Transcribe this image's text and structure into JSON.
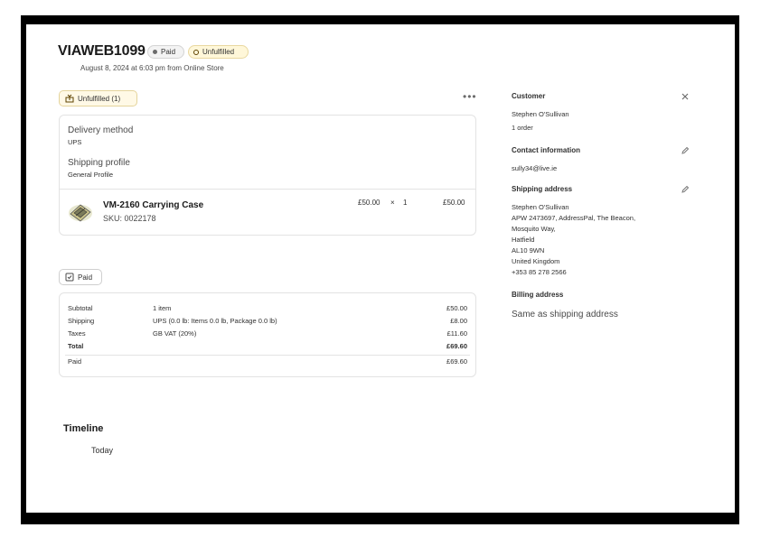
{
  "order": {
    "title": "VIAWEB1099",
    "badge_paid": "Paid",
    "badge_unfulfilled": "Unfulfilled",
    "subtitle": "August 8, 2024 at 6:03 pm from Online Store"
  },
  "fulfillment": {
    "status_label": "Unfulfilled (1)",
    "delivery_method_label": "Delivery method",
    "delivery_method_value": "UPS",
    "shipping_profile_label": "Shipping profile",
    "shipping_profile_value": "General Profile",
    "item": {
      "name": "VM-2160 Carrying Case",
      "sku": "SKU: 0022178",
      "price": "£50.00",
      "times": "×",
      "qty": "1",
      "total": "£50.00"
    }
  },
  "payment": {
    "status_label": "Paid",
    "rows": [
      {
        "label": "Subtotal",
        "detail": "1 item",
        "amount": "£50.00"
      },
      {
        "label": "Shipping",
        "detail": "UPS (0.0 lb: Items 0.0 lb, Package 0.0 lb)",
        "amount": "£8.00"
      },
      {
        "label": "Taxes",
        "detail": "GB VAT (20%)",
        "amount": "£11.60"
      },
      {
        "label": "Total",
        "detail": "",
        "amount": "£69.60"
      },
      {
        "label": "Paid",
        "detail": "",
        "amount": "£69.60"
      }
    ]
  },
  "timeline": {
    "heading": "Timeline",
    "today": "Today"
  },
  "customer": {
    "heading": "Customer",
    "name": "Stephen O'Sullivan",
    "orders": "1 order",
    "contact_heading": "Contact information",
    "email": "sully34@live.ie",
    "shipping_heading": "Shipping address",
    "shipping_lines": [
      "Stephen O'Sullivan",
      "APW 2473697, AddressPal, The Beacon,",
      "Mosquito Way,",
      "Hatfield",
      "AL10 9WN",
      "United Kingdom",
      "+353 85 278 2566"
    ],
    "billing_heading": "Billing address",
    "billing_value": "Same as shipping address"
  },
  "icons": {
    "more": "more-horizontal-icon",
    "close": "close-icon",
    "edit": "pencil-icon",
    "unfulfilled": "fulfillment-icon",
    "paid": "receipt-check-icon"
  },
  "colors": {
    "unfulfilled_bg": "#fff7d9",
    "paid_bg": "#f3f3f3"
  }
}
